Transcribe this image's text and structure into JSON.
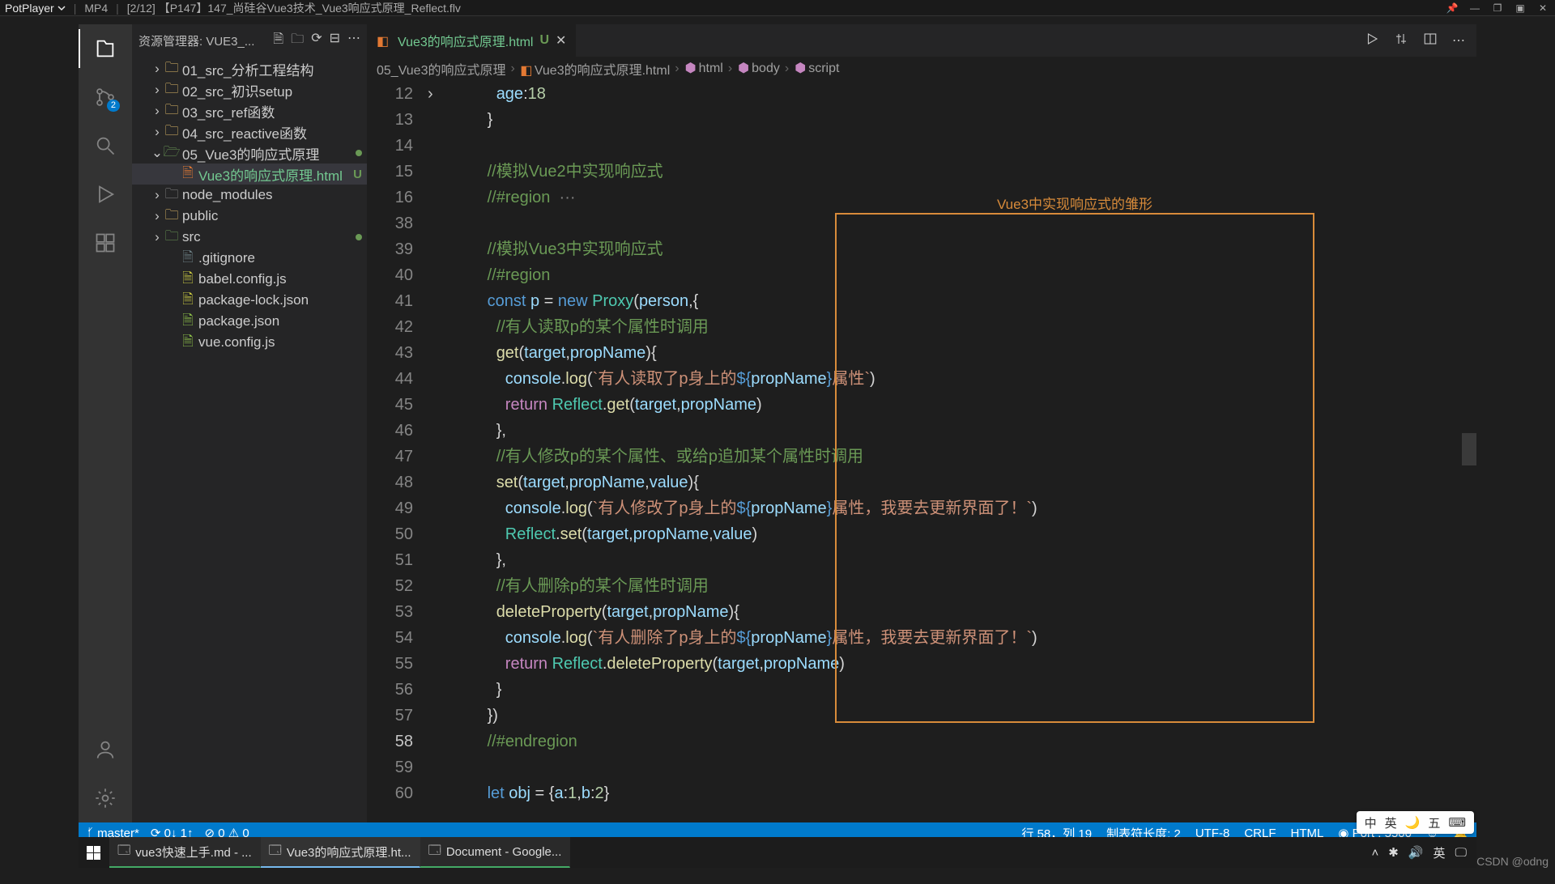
{
  "player": {
    "name": "PotPlayer",
    "ext": "MP4",
    "track": "[2/12]  【P147】147_尚硅谷Vue3技术_Vue3响应式原理_Reflect.flv"
  },
  "explorer": {
    "title": "资源管理器: VUE3_...",
    "tree": [
      {
        "depth": 1,
        "kind": "folder",
        "open": false,
        "label": "01_src_分析工程结构",
        "color": "fold-y"
      },
      {
        "depth": 1,
        "kind": "folder",
        "open": false,
        "label": "02_src_初识setup",
        "color": "fold-y"
      },
      {
        "depth": 1,
        "kind": "folder",
        "open": false,
        "label": "03_src_ref函数",
        "color": "fold-y"
      },
      {
        "depth": 1,
        "kind": "folder",
        "open": false,
        "label": "04_src_reactive函数",
        "color": "fold-y"
      },
      {
        "depth": 1,
        "kind": "folder",
        "open": true,
        "label": "05_Vue3的响应式原理",
        "color": "fold-g",
        "git": "dot"
      },
      {
        "depth": 2,
        "kind": "file",
        "label": "Vue3的响应式原理.html",
        "color": "file-o",
        "git": "U",
        "sel": true,
        "classExtra": "git-new"
      },
      {
        "depth": 1,
        "kind": "folder",
        "open": false,
        "label": "node_modules",
        "color": "fold-gr"
      },
      {
        "depth": 1,
        "kind": "folder",
        "open": false,
        "label": "public",
        "color": "fold-y"
      },
      {
        "depth": 1,
        "kind": "folder",
        "open": false,
        "label": "src",
        "color": "fold-g",
        "git": "dot"
      },
      {
        "depth": 2,
        "kind": "file",
        "label": ".gitignore",
        "color": "file-gr"
      },
      {
        "depth": 2,
        "kind": "file",
        "label": "babel.config.js",
        "color": "file-y"
      },
      {
        "depth": 2,
        "kind": "file",
        "label": "package-lock.json",
        "color": "file-y"
      },
      {
        "depth": 2,
        "kind": "file",
        "label": "package.json",
        "color": "file-g"
      },
      {
        "depth": 2,
        "kind": "file",
        "label": "vue.config.js",
        "color": "file-g"
      }
    ]
  },
  "scm_badge": "2",
  "tab": {
    "label": "Vue3的响应式原理.html",
    "status": "U"
  },
  "breadcrumb": [
    "05_Vue3的响应式原理",
    "Vue3的响应式原理.html",
    "html",
    "body",
    "script"
  ],
  "annotation_label": "Vue3中实现响应式的雏形",
  "code": {
    "lines": [
      {
        "n": 12,
        "indent": 6,
        "tokens": [
          [
            "v",
            "age"
          ],
          [
            "p",
            ":"
          ],
          [
            "n",
            "18"
          ]
        ]
      },
      {
        "n": 13,
        "indent": 5,
        "tokens": [
          [
            "p",
            "}"
          ]
        ]
      },
      {
        "n": 14,
        "indent": 0,
        "tokens": []
      },
      {
        "n": 15,
        "indent": 5,
        "tokens": [
          [
            "c",
            "//模拟Vue2中实现响应式"
          ]
        ]
      },
      {
        "n": 16,
        "indent": 5,
        "fold": true,
        "tokens": [
          [
            "c",
            "//#region"
          ],
          [
            "p",
            "  "
          ],
          [
            "coll",
            "···"
          ]
        ]
      },
      {
        "n": 38,
        "indent": 0,
        "tokens": []
      },
      {
        "n": 39,
        "indent": 5,
        "tokens": [
          [
            "c",
            "//模拟Vue3中实现响应式"
          ]
        ]
      },
      {
        "n": 40,
        "indent": 5,
        "tokens": [
          [
            "c",
            "//#region"
          ]
        ]
      },
      {
        "n": 41,
        "indent": 5,
        "tokens": [
          [
            "kb",
            "const"
          ],
          [
            "p",
            " "
          ],
          [
            "v",
            "p"
          ],
          [
            "p",
            " = "
          ],
          [
            "kb",
            "new"
          ],
          [
            "p",
            " "
          ],
          [
            "cls",
            "Proxy"
          ],
          [
            "p",
            "("
          ],
          [
            "v",
            "person"
          ],
          [
            "p",
            ",{"
          ]
        ]
      },
      {
        "n": 42,
        "indent": 6,
        "tokens": [
          [
            "c",
            "//有人读取p的某个属性时调用"
          ]
        ]
      },
      {
        "n": 43,
        "indent": 6,
        "tokens": [
          [
            "fn",
            "get"
          ],
          [
            "p",
            "("
          ],
          [
            "v",
            "target"
          ],
          [
            "p",
            ","
          ],
          [
            "v",
            "propName"
          ],
          [
            "p",
            "){"
          ]
        ]
      },
      {
        "n": 44,
        "indent": 7,
        "tokens": [
          [
            "v",
            "console"
          ],
          [
            "p",
            "."
          ],
          [
            "fn",
            "log"
          ],
          [
            "p",
            "("
          ],
          [
            "s",
            "`有人读取了p身上的"
          ],
          [
            "kb",
            "${"
          ],
          [
            "v",
            "propName"
          ],
          [
            "kb",
            "}"
          ],
          [
            "s",
            "属性`"
          ],
          [
            "p",
            ")"
          ]
        ]
      },
      {
        "n": 45,
        "indent": 7,
        "tokens": [
          [
            "k",
            "return"
          ],
          [
            "p",
            " "
          ],
          [
            "cls",
            "Reflect"
          ],
          [
            "p",
            "."
          ],
          [
            "fn",
            "get"
          ],
          [
            "p",
            "("
          ],
          [
            "v",
            "target"
          ],
          [
            "p",
            ","
          ],
          [
            "v",
            "propName"
          ],
          [
            "p",
            ")"
          ]
        ]
      },
      {
        "n": 46,
        "indent": 6,
        "tokens": [
          [
            "p",
            "},"
          ]
        ]
      },
      {
        "n": 47,
        "indent": 6,
        "tokens": [
          [
            "c",
            "//有人修改p的某个属性、或给p追加某个属性时调用"
          ]
        ]
      },
      {
        "n": 48,
        "indent": 6,
        "tokens": [
          [
            "fn",
            "set"
          ],
          [
            "p",
            "("
          ],
          [
            "v",
            "target"
          ],
          [
            "p",
            ","
          ],
          [
            "v",
            "propName"
          ],
          [
            "p",
            ","
          ],
          [
            "v",
            "value"
          ],
          [
            "p",
            "){"
          ]
        ]
      },
      {
        "n": 49,
        "indent": 7,
        "tokens": [
          [
            "v",
            "console"
          ],
          [
            "p",
            "."
          ],
          [
            "fn",
            "log"
          ],
          [
            "p",
            "("
          ],
          [
            "s",
            "`有人修改了p身上的"
          ],
          [
            "kb",
            "${"
          ],
          [
            "v",
            "propName"
          ],
          [
            "kb",
            "}"
          ],
          [
            "s",
            "属性，我要去更新界面了！`"
          ],
          [
            "p",
            ")"
          ]
        ]
      },
      {
        "n": 50,
        "indent": 7,
        "tokens": [
          [
            "cls",
            "Reflect"
          ],
          [
            "p",
            "."
          ],
          [
            "fn",
            "set"
          ],
          [
            "p",
            "("
          ],
          [
            "v",
            "target"
          ],
          [
            "p",
            ","
          ],
          [
            "v",
            "propName"
          ],
          [
            "p",
            ","
          ],
          [
            "v",
            "value"
          ],
          [
            "p",
            ")"
          ]
        ]
      },
      {
        "n": 51,
        "indent": 6,
        "tokens": [
          [
            "p",
            "},"
          ]
        ]
      },
      {
        "n": 52,
        "indent": 6,
        "tokens": [
          [
            "c",
            "//有人删除p的某个属性时调用"
          ]
        ]
      },
      {
        "n": 53,
        "indent": 6,
        "tokens": [
          [
            "fn",
            "deleteProperty"
          ],
          [
            "p",
            "("
          ],
          [
            "v",
            "target"
          ],
          [
            "p",
            ","
          ],
          [
            "v",
            "propName"
          ],
          [
            "p",
            "){"
          ]
        ]
      },
      {
        "n": 54,
        "indent": 7,
        "tokens": [
          [
            "v",
            "console"
          ],
          [
            "p",
            "."
          ],
          [
            "fn",
            "log"
          ],
          [
            "p",
            "("
          ],
          [
            "s",
            "`有人删除了p身上的"
          ],
          [
            "kb",
            "${"
          ],
          [
            "v",
            "propName"
          ],
          [
            "kb",
            "}"
          ],
          [
            "s",
            "属性，我要去更新界面了！`"
          ],
          [
            "p",
            ")"
          ]
        ]
      },
      {
        "n": 55,
        "indent": 7,
        "tokens": [
          [
            "k",
            "return"
          ],
          [
            "p",
            " "
          ],
          [
            "cls",
            "Reflect"
          ],
          [
            "p",
            "."
          ],
          [
            "fn",
            "deleteProperty"
          ],
          [
            "p",
            "("
          ],
          [
            "v",
            "target"
          ],
          [
            "p",
            ","
          ],
          [
            "v",
            "propName"
          ],
          [
            "p",
            ")"
          ]
        ]
      },
      {
        "n": 56,
        "indent": 6,
        "tokens": [
          [
            "p",
            "}"
          ]
        ]
      },
      {
        "n": 57,
        "indent": 5,
        "tokens": [
          [
            "p",
            "})"
          ]
        ]
      },
      {
        "n": 58,
        "indent": 5,
        "cur": true,
        "tokens": [
          [
            "c",
            "//#endregion"
          ]
        ]
      },
      {
        "n": 59,
        "indent": 0,
        "tokens": []
      },
      {
        "n": 60,
        "indent": 5,
        "tokens": [
          [
            "kb",
            "let"
          ],
          [
            "p",
            " "
          ],
          [
            "v",
            "obj"
          ],
          [
            "p",
            " = {"
          ],
          [
            "v",
            "a"
          ],
          [
            "p",
            ":"
          ],
          [
            "n",
            "1"
          ],
          [
            "p",
            ","
          ],
          [
            "v",
            "b"
          ],
          [
            "p",
            ":"
          ],
          [
            "n",
            "2"
          ],
          [
            "p",
            "}"
          ]
        ]
      }
    ]
  },
  "status": {
    "branch": "master*",
    "sync": "0↓ 1↑",
    "problems": "⊘ 0 ⚠ 0",
    "pos": "行 58，列 19",
    "tab": "制表符长度: 2",
    "enc": "UTF-8",
    "eol": "CRLF",
    "lang": "HTML",
    "port": "Port : 5500"
  },
  "taskbar": {
    "items": [
      {
        "label": "vue3快速上手.md - ...",
        "active": false
      },
      {
        "label": "Vue3的响应式原理.ht...",
        "active": true
      },
      {
        "label": "Document - Google...",
        "active": false
      }
    ]
  },
  "ime": {
    "items": [
      "中",
      "英",
      "🌙",
      "五",
      "⌨"
    ]
  },
  "watermark": "CSDN @odng"
}
